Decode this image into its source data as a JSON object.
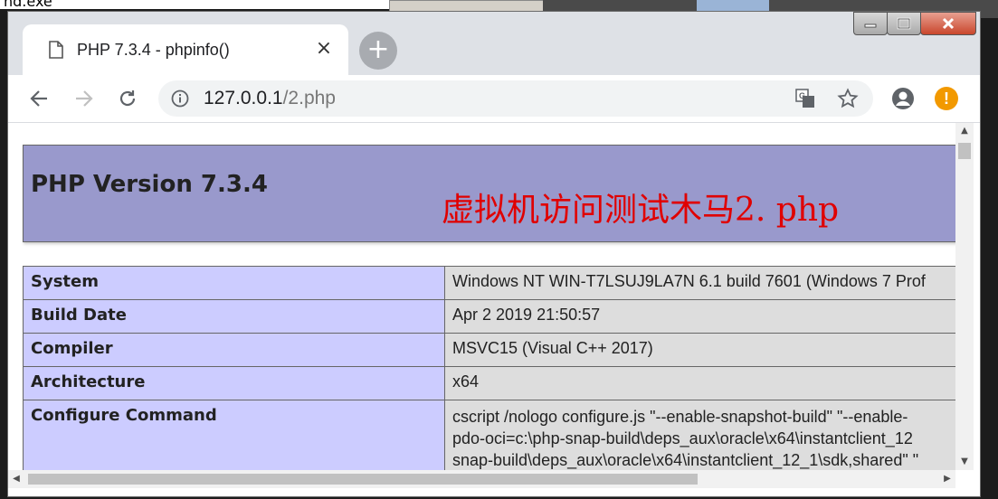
{
  "background": {
    "process_text": "nd.exe"
  },
  "browser": {
    "tab": {
      "title": "PHP 7.3.4 - phpinfo()",
      "close_label": "×"
    },
    "new_tab_label": "+",
    "address": {
      "host": "127.0.0.1",
      "path": "/2.php"
    },
    "alert_label": "!"
  },
  "page": {
    "php_version": "PHP Version 7.3.4",
    "annotation": "虚拟机访问测试木马2. php",
    "rows": [
      {
        "key": "System",
        "value": "Windows NT WIN-T7LSUJ9LA7N 6.1 build 7601 (Windows 7 Prof"
      },
      {
        "key": "Build Date",
        "value": "Apr 2 2019 21:50:57"
      },
      {
        "key": "Compiler",
        "value": "MSVC15 (Visual C++ 2017)"
      },
      {
        "key": "Architecture",
        "value": "x64"
      },
      {
        "key": "Configure Command",
        "lines": [
          "cscript /nologo configure.js \"--enable-snapshot-build\" \"--enable-",
          "pdo-oci=c:\\php-snap-build\\deps_aux\\oracle\\x64\\instantclient_12",
          "snap-build\\deps_aux\\oracle\\x64\\instantclient_12_1\\sdk,shared\" \""
        ]
      }
    ]
  },
  "colors": {
    "header_bg": "#9999cc",
    "key_bg": "#ccccff",
    "value_bg": "#dddddd",
    "annotation": "#e00000",
    "alert": "#f29900"
  }
}
